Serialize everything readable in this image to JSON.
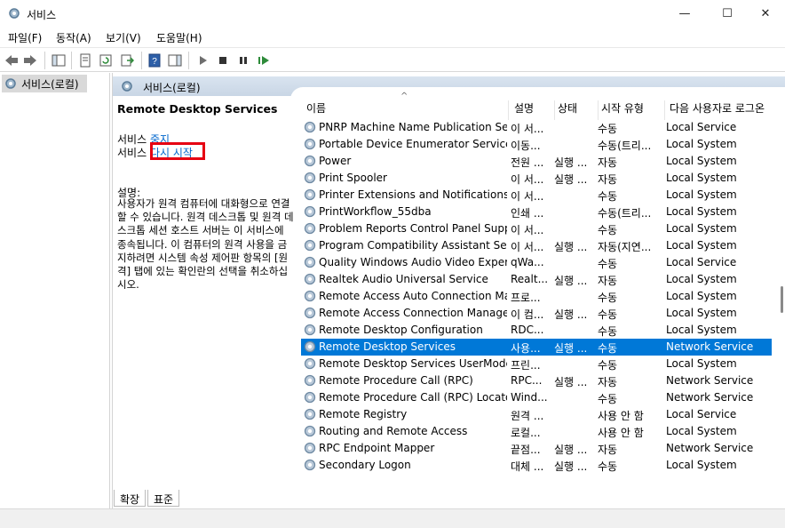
{
  "window": {
    "title": "서비스"
  },
  "menu": [
    "파일(F)",
    "동작(A)",
    "보기(V)",
    "도움말(H)"
  ],
  "tree": {
    "root": "서비스(로컬)"
  },
  "pane_header": "서비스(로컬)",
  "details": {
    "service_name": "Remote Desktop Services",
    "stop_prefix": "서비스",
    "stop_link": "중지",
    "restart_prefix": "서비스",
    "restart_link": "다시 시작",
    "desc_label": "설명:",
    "description": "사용자가 원격 컴퓨터에 대화형으로 연결할 수 있습니다. 원격 데스크톱 및 원격 데스크톱 세션 호스트 서버는 이 서비스에 종속됩니다. 이 컴퓨터의 원격 사용을 금지하려면 시스템 속성 제어판 항목의 [원격] 탭에 있는 확인란의 선택을 취소하십시오."
  },
  "columns": {
    "name": "이름",
    "desc": "설명",
    "status": "상태",
    "startup": "시작 유형",
    "logon": "다음 사용자로 로그온"
  },
  "rows": [
    {
      "name": "PNRP Machine Name Publication Ser...",
      "desc": "이 서...",
      "status": "",
      "startup": "수동",
      "logon": "Local Service"
    },
    {
      "name": "Portable Device Enumerator Service",
      "desc": "이동...",
      "status": "",
      "startup": "수동(트리...",
      "logon": "Local System"
    },
    {
      "name": "Power",
      "desc": "전원 ...",
      "status": "실행 ...",
      "startup": "자동",
      "logon": "Local System"
    },
    {
      "name": "Print Spooler",
      "desc": "이 서...",
      "status": "실행 ...",
      "startup": "자동",
      "logon": "Local System"
    },
    {
      "name": "Printer Extensions and Notifications",
      "desc": "이 서...",
      "status": "",
      "startup": "수동",
      "logon": "Local System"
    },
    {
      "name": "PrintWorkflow_55dba",
      "desc": "인쇄 ...",
      "status": "",
      "startup": "수동(트리...",
      "logon": "Local System"
    },
    {
      "name": "Problem Reports Control Panel Supp...",
      "desc": "이 서...",
      "status": "",
      "startup": "수동",
      "logon": "Local System"
    },
    {
      "name": "Program Compatibility Assistant Serv...",
      "desc": "이 서...",
      "status": "실행 ...",
      "startup": "자동(지연...",
      "logon": "Local System"
    },
    {
      "name": "Quality Windows Audio Video Experi...",
      "desc": "qWa...",
      "status": "",
      "startup": "수동",
      "logon": "Local Service"
    },
    {
      "name": "Realtek Audio Universal Service",
      "desc": "Realt...",
      "status": "실행 ...",
      "startup": "자동",
      "logon": "Local System"
    },
    {
      "name": "Remote Access Auto Connection Ma...",
      "desc": "프로...",
      "status": "",
      "startup": "수동",
      "logon": "Local System"
    },
    {
      "name": "Remote Access Connection Manager",
      "desc": "이 컴...",
      "status": "실행 ...",
      "startup": "수동",
      "logon": "Local System"
    },
    {
      "name": "Remote Desktop Configuration",
      "desc": "RDC...",
      "status": "",
      "startup": "수동",
      "logon": "Local System"
    },
    {
      "name": "Remote Desktop Services",
      "desc": "사용...",
      "status": "실행 ...",
      "startup": "수동",
      "logon": "Network Service",
      "selected": true
    },
    {
      "name": "Remote Desktop Services UserMode ...",
      "desc": "프린...",
      "status": "",
      "startup": "수동",
      "logon": "Local System"
    },
    {
      "name": "Remote Procedure Call (RPC)",
      "desc": "RPC...",
      "status": "실행 ...",
      "startup": "자동",
      "logon": "Network Service"
    },
    {
      "name": "Remote Procedure Call (RPC) Locator",
      "desc": "Wind...",
      "status": "",
      "startup": "수동",
      "logon": "Network Service"
    },
    {
      "name": "Remote Registry",
      "desc": "원격 ...",
      "status": "",
      "startup": "사용 안 함",
      "logon": "Local Service"
    },
    {
      "name": "Routing and Remote Access",
      "desc": "로컬...",
      "status": "",
      "startup": "사용 안 함",
      "logon": "Local System"
    },
    {
      "name": "RPC Endpoint Mapper",
      "desc": "끝점...",
      "status": "실행 ...",
      "startup": "자동",
      "logon": "Network Service"
    },
    {
      "name": "Secondary Logon",
      "desc": "대체 ...",
      "status": "실행 ...",
      "startup": "수동",
      "logon": "Local System"
    }
  ],
  "tabs": [
    "확장",
    "표준"
  ],
  "colors": {
    "selection": "#0078d7",
    "link": "#0066cc",
    "highlight_box": "#e60012"
  }
}
